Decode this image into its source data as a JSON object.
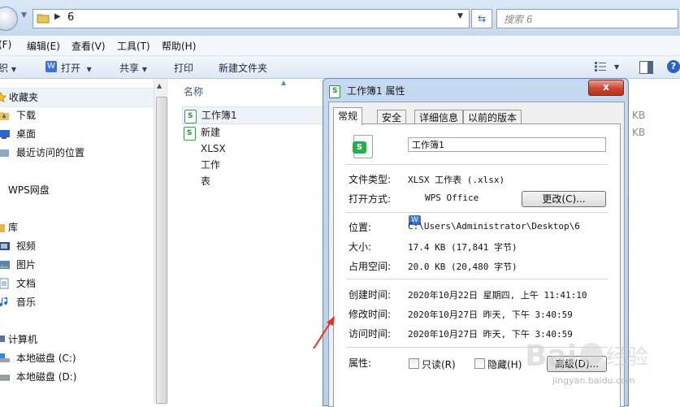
{
  "address_bar": {
    "path": "6",
    "search_placeholder": "搜索 6"
  },
  "menu": [
    {
      "label": "(F)",
      "key": "file"
    },
    {
      "label": "编辑(E)",
      "key": "edit"
    },
    {
      "label": "查看(V)",
      "key": "view"
    },
    {
      "label": "工具(T)",
      "key": "tools"
    },
    {
      "label": "帮助(H)",
      "key": "help"
    }
  ],
  "toolbar": {
    "organize": "织",
    "open": "打开",
    "share": "共享",
    "print": "打印",
    "new_folder": "新建文件夹"
  },
  "nav": {
    "favorites": "收藏夹",
    "downloads": "下载",
    "desktop": "桌面",
    "recent": "最近访问的位置",
    "wps_drive": "WPS网盘",
    "libraries": "库",
    "videos": "视频",
    "pictures": "图片",
    "documents": "文档",
    "music": "音乐",
    "computer": "计算机",
    "drive_c": "本地磁盘 (C:)",
    "drive_d": "本地磁盘 (D:)"
  },
  "file_list": {
    "column_name": "名称",
    "files": [
      {
        "name": "工作簿1",
        "size_suffix": "KB"
      },
      {
        "name": "新建 XLSX 工作表",
        "size_suffix": "KB"
      }
    ]
  },
  "dialog": {
    "title": "工作簿1 属性",
    "close": "x",
    "tabs": [
      "常规",
      "安全",
      "详细信息",
      "以前的版本"
    ],
    "file_name": "工作簿1",
    "file_type_label": "文件类型:",
    "file_type_value": "XLSX 工作表 (.xlsx)",
    "opens_with_label": "打开方式:",
    "opens_with_value": "WPS Office",
    "change_button": "更改(C)...",
    "location_label": "位置:",
    "location_value": "C:\\Users\\Administrator\\Desktop\\6",
    "size_label": "大小:",
    "size_value": "17.4 KB (17,841 字节)",
    "size_on_disk_label": "占用空间:",
    "size_on_disk_value": "20.0 KB (20,480 字节)",
    "created_label": "创建时间:",
    "created_value": "2020年10月22日 星期四, 上午 11:41:10",
    "modified_label": "修改时间:",
    "modified_value": "2020年10月27日 昨天, 下午 3:40:59",
    "accessed_label": "访问时间:",
    "accessed_value": "2020年10月27日 昨天, 下午 3:40:59",
    "attributes_label": "属性:",
    "readonly_label": "只读(R)",
    "hidden_label": "隐藏(H)",
    "advanced_button": "高级(D)..."
  },
  "watermark": {
    "logo_text": "Baidu经验",
    "url": "jingyan.baidu.com"
  },
  "colors": {
    "annotation_arrow": "#e8321e",
    "wps_blue": "#3b73d8",
    "xlsx_green": "#2eaa4f"
  }
}
